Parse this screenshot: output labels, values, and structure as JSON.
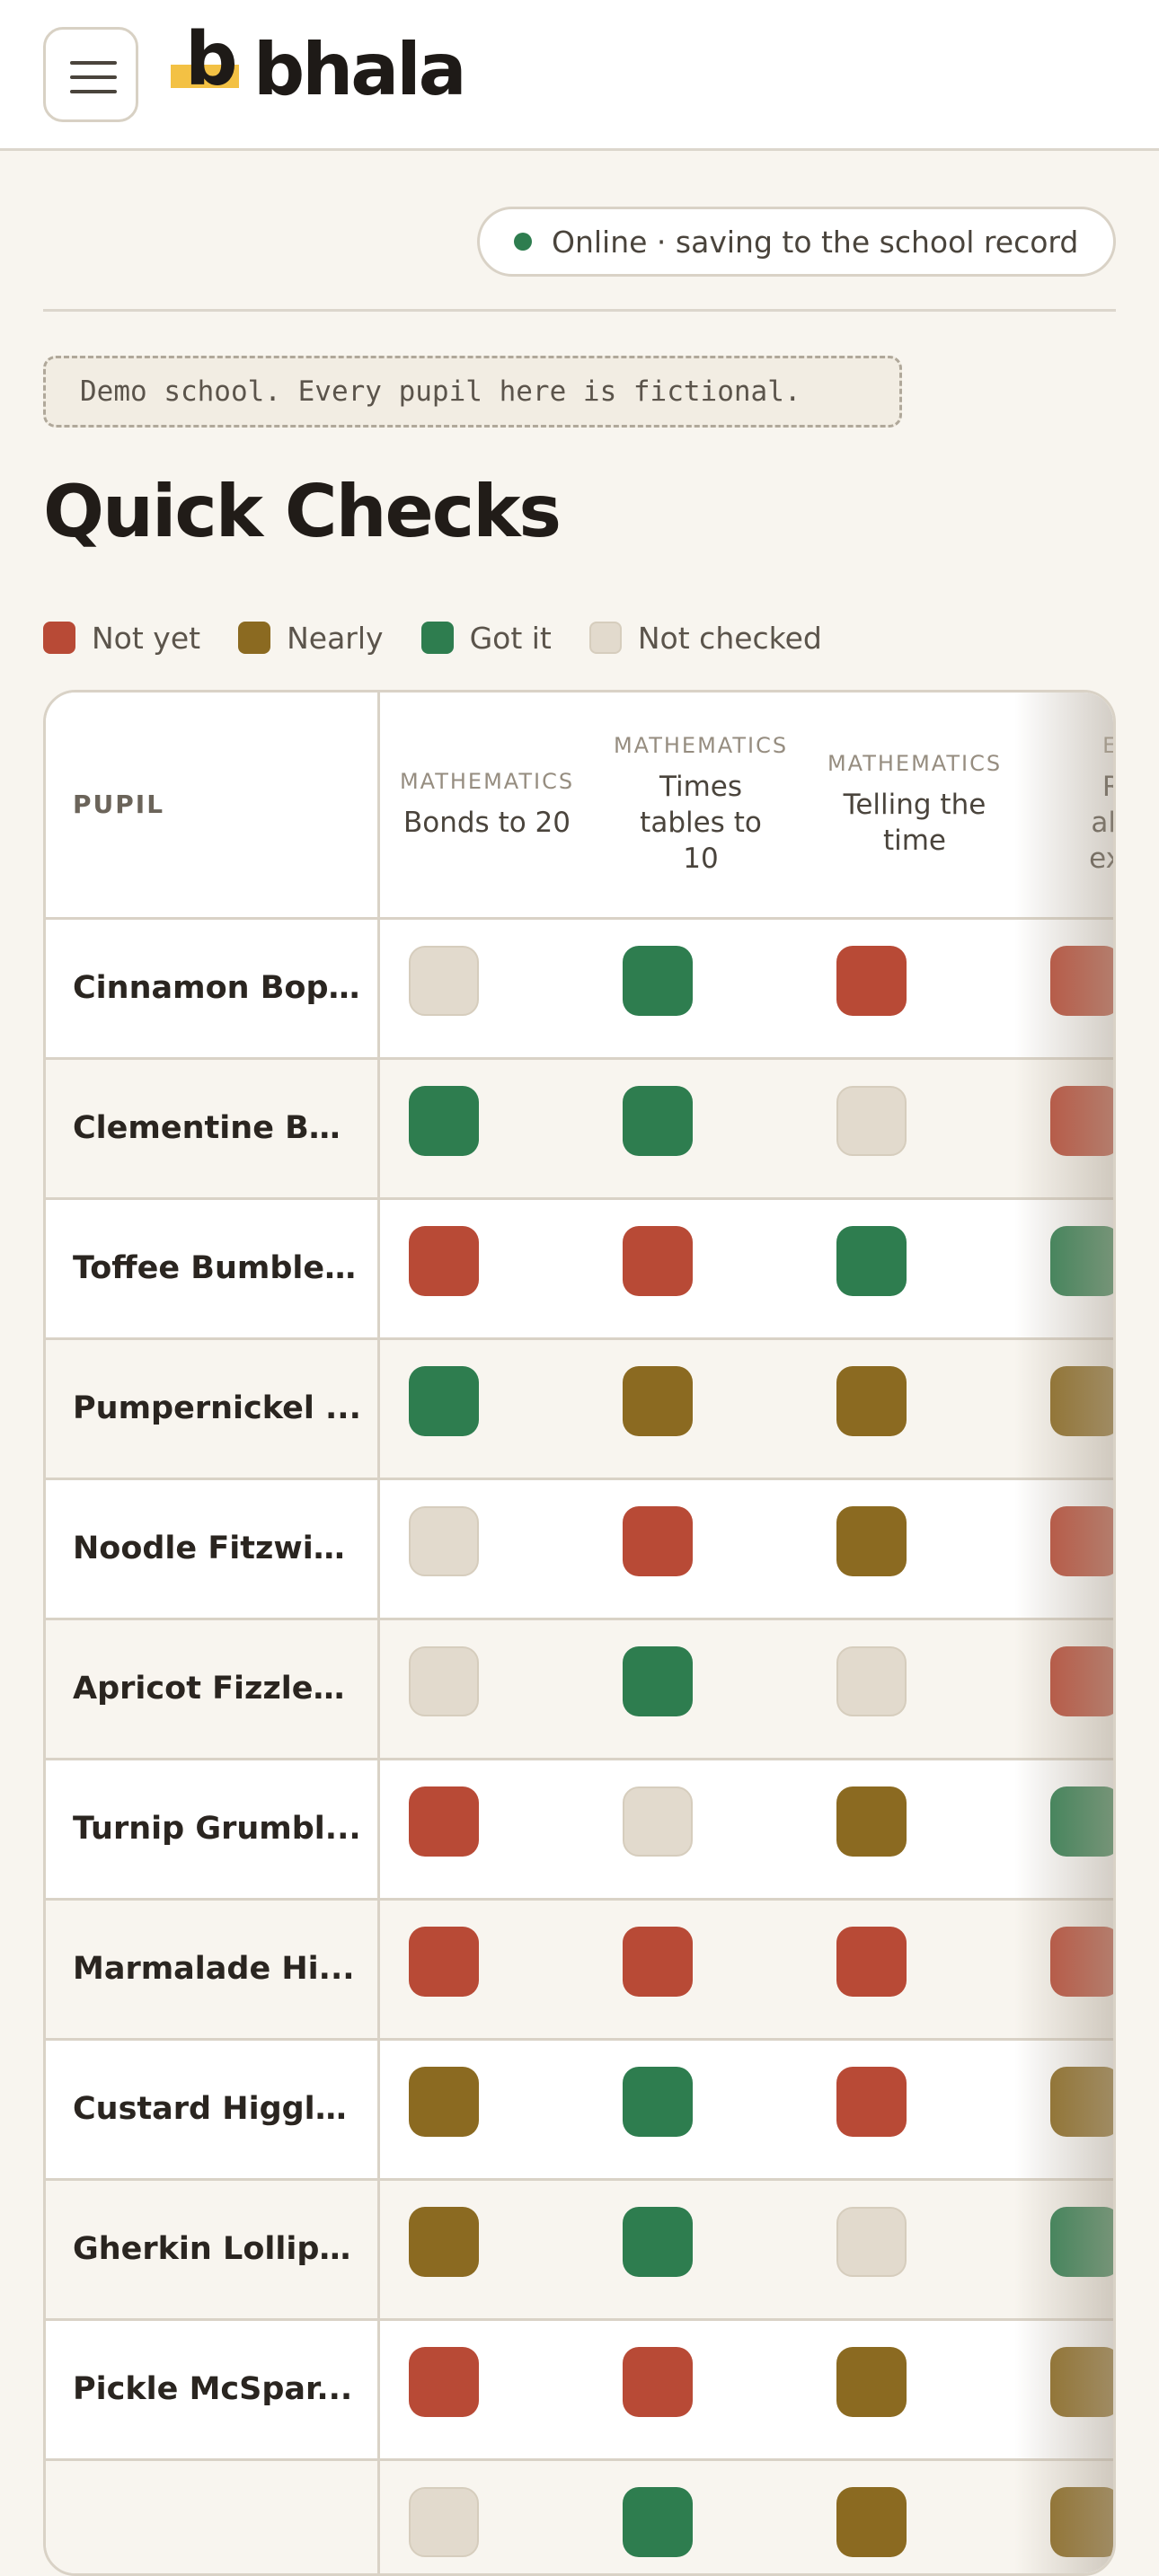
{
  "brand": {
    "logo_letter": "b",
    "name": "bhala"
  },
  "status": {
    "text": "Online · saving to the school record",
    "color": "#2e7d4f"
  },
  "demo_notice": "Demo school. Every pupil here is fictional.",
  "page_title": "Quick Checks",
  "legend": [
    {
      "label": "Not yet",
      "color": "#b84a36"
    },
    {
      "label": "Nearly",
      "color": "#8b6a21"
    },
    {
      "label": "Got it",
      "color": "#2e7d4f"
    },
    {
      "label": "Not checked",
      "color": "#e2dacd"
    }
  ],
  "grid": {
    "pupil_header": "PUPIL",
    "columns": [
      {
        "subject": "MATHEMATICS",
        "name": "Bonds to 20"
      },
      {
        "subject": "MATHEMATICS",
        "name": "Times tables to 10"
      },
      {
        "subject": "MATHEMATICS",
        "name": "Telling the time"
      },
      {
        "subject": "ENG",
        "name": "Rea alouc expre"
      }
    ],
    "rows": [
      {
        "pupil": "Cinnamon Bop...",
        "marks": [
          3,
          2,
          0,
          0
        ]
      },
      {
        "pupil": "Clementine Bu...",
        "marks": [
          2,
          2,
          3,
          0
        ]
      },
      {
        "pupil": "Toffee Bumbles...",
        "marks": [
          0,
          0,
          2,
          2
        ]
      },
      {
        "pupil": "Pumpernickel ...",
        "marks": [
          2,
          1,
          1,
          1
        ]
      },
      {
        "pupil": "Noodle Fitzwig...",
        "marks": [
          3,
          0,
          1,
          0
        ]
      },
      {
        "pupil": "Apricot Fizzleb...",
        "marks": [
          3,
          2,
          3,
          0
        ]
      },
      {
        "pupil": "Turnip Grumbl...",
        "marks": [
          0,
          3,
          1,
          2
        ]
      },
      {
        "pupil": "Marmalade Hi...",
        "marks": [
          0,
          0,
          0,
          0
        ]
      },
      {
        "pupil": "Custard Higgle...",
        "marks": [
          1,
          2,
          0,
          1
        ]
      },
      {
        "pupil": "Gherkin Lollipo...",
        "marks": [
          1,
          2,
          3,
          2
        ]
      },
      {
        "pupil": "Pickle McSpar...",
        "marks": [
          0,
          0,
          1,
          1
        ]
      },
      {
        "pupil": "",
        "marks": [
          3,
          2,
          1,
          1
        ]
      }
    ]
  }
}
